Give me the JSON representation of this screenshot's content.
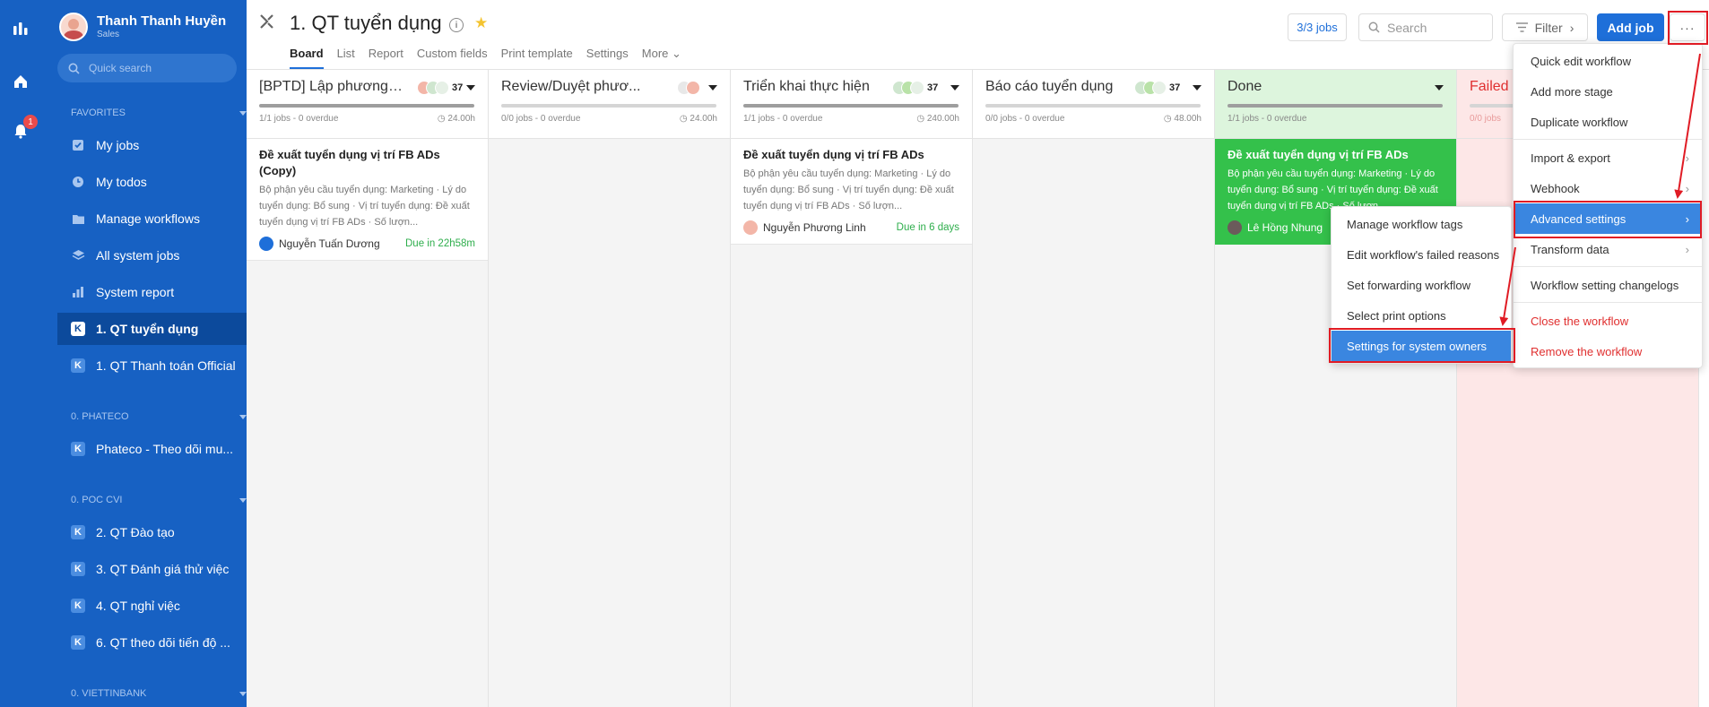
{
  "sidebar": {
    "user": {
      "name": "Thanh Thanh Huyền",
      "role": "Sales"
    },
    "search_placeholder": "Quick search",
    "notification_count": "1",
    "favorites_label": "FAVORITES",
    "favorites": [
      {
        "label": "My jobs",
        "icon": "checkbox-icon"
      },
      {
        "label": "My todos",
        "icon": "clock-icon"
      },
      {
        "label": "Manage workflows",
        "icon": "folder-icon"
      },
      {
        "label": "All system jobs",
        "icon": "layers-icon"
      },
      {
        "label": "System report",
        "icon": "bar-chart-icon"
      },
      {
        "label": "1. QT tuyển dụng",
        "icon": "workflow-icon",
        "active": true
      },
      {
        "label": "1. QT Thanh toán Official",
        "icon": "workflow-icon"
      }
    ],
    "group1_label": "0. PHATECO",
    "group1": [
      {
        "label": "Phateco - Theo dõi mu..."
      }
    ],
    "group2_label": "0. POC CVI",
    "group2": [
      {
        "label": "2. QT Đào tạo"
      },
      {
        "label": "3. QT Đánh giá thử việc"
      },
      {
        "label": "4. QT nghỉ việc"
      },
      {
        "label": "6. QT theo dõi tiến độ ..."
      }
    ],
    "group3_label": "0. VIETTINBANK"
  },
  "header": {
    "title": "1. QT tuyển dụng",
    "info_glyph": "i",
    "tabs": [
      "Board",
      "List",
      "Report",
      "Custom fields",
      "Print template",
      "Settings",
      "More"
    ],
    "jobs_count": "3/3 jobs",
    "search_placeholder": "Search",
    "filter_label": "Filter",
    "add_job_label": "Add job",
    "more_label": "···"
  },
  "columns": [
    {
      "name": "[BPTD] Lập phương ...",
      "count": "37",
      "meta": "1/1 jobs - 0 overdue",
      "hours": "24.00h",
      "progress": 1.0,
      "card": {
        "title": "Đề xuất tuyển dụng vị trí FB ADs (Copy)",
        "desc": "Bộ phận yêu cầu tuyển dụng: Marketing · Lý do tuyển dụng: Bổ sung · Vị trí tuyển dụng: Đề xuất tuyển dụng vị trí FB ADs · Số lượn...",
        "person": "Nguyễn Tuấn Dương",
        "due": "Due in 22h58m"
      }
    },
    {
      "name": "Review/Duyệt phươ...",
      "count": "",
      "meta": "0/0 jobs - 0 overdue",
      "hours": "24.00h",
      "progress": 0.0
    },
    {
      "name": "Triển khai thực hiện",
      "count": "37",
      "meta": "1/1 jobs - 0 overdue",
      "hours": "240.00h",
      "progress": 1.0,
      "card": {
        "title": "Đề xuất tuyển dụng vị trí FB ADs",
        "desc": "Bộ phận yêu cầu tuyển dụng: Marketing · Lý do tuyển dụng: Bổ sung · Vị trí tuyển dụng: Đề xuất tuyển dụng vị trí FB ADs · Số lượn...",
        "person": "Nguyễn Phương Linh",
        "due": "Due in 6 days"
      }
    },
    {
      "name": "Báo cáo tuyển dụng",
      "count": "37",
      "meta": "0/0 jobs - 0 overdue",
      "hours": "48.00h",
      "progress": 0.0
    },
    {
      "name": "Done",
      "count": "",
      "meta": "1/1 jobs - 0 overdue",
      "hours": "",
      "progress": 1.0,
      "card": {
        "title": "Đề xuất tuyển dụng vị trí FB ADs",
        "desc": "Bộ phận yêu cầu tuyển dụng: Marketing · Lý do tuyển dụng: Bổ sung · Vị trí tuyển dụng: Đề xuất tuyển dụng vị trí FB ADs · Số lượn...",
        "person": "Lê Hồng Nhung",
        "due": ""
      }
    },
    {
      "name": "Failed",
      "count": "",
      "meta": "0/0 jobs",
      "hours": "",
      "progress": 0.0
    }
  ],
  "more_menu": [
    "Quick edit workflow",
    "Add more stage",
    "Duplicate workflow",
    "Import & export",
    "Webhook",
    "Advanced settings",
    "Transform data",
    "Workflow setting changelogs",
    "Close the workflow",
    "Remove the workflow"
  ],
  "advanced_submenu": [
    "Manage workflow tags",
    "Edit workflow's failed reasons",
    "Set forwarding workflow",
    "Select print options",
    "Settings for system owners"
  ],
  "colors": {
    "sidebar": "#1761c3",
    "accent": "#1e6fd9",
    "done": "#34c14b",
    "failed": "#fde7e7",
    "highlight": "#3a86e0",
    "annotation": "#e01b24"
  }
}
